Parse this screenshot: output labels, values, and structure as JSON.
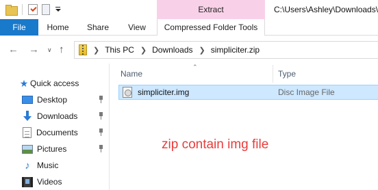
{
  "titlebar": {
    "contextual_tab": "Extract",
    "path": "C:\\Users\\Ashley\\Downloads\\"
  },
  "ribbon": {
    "tabs": [
      "File",
      "Home",
      "Share",
      "View",
      "Compressed Folder Tools"
    ]
  },
  "address": {
    "crumbs": [
      "This PC",
      "Downloads",
      "simpliciter.zip"
    ]
  },
  "sidebar": {
    "items": [
      {
        "label": "Quick access",
        "icon": "star-icon"
      },
      {
        "label": "Desktop",
        "icon": "desktop-icon",
        "pinned": true
      },
      {
        "label": "Downloads",
        "icon": "download-icon",
        "pinned": true
      },
      {
        "label": "Documents",
        "icon": "documents-icon",
        "pinned": true
      },
      {
        "label": "Pictures",
        "icon": "pictures-icon",
        "pinned": true
      },
      {
        "label": "Music",
        "icon": "music-icon"
      },
      {
        "label": "Videos",
        "icon": "videos-icon"
      }
    ]
  },
  "list": {
    "columns": [
      "Name",
      "Type"
    ],
    "rows": [
      {
        "name": "simpliciter.img",
        "type": "Disc Image File",
        "icon": "disc-image-icon",
        "selected": true
      }
    ]
  },
  "annotation": "zip contain img file",
  "colors": {
    "file_tab": "#1979ca",
    "contextual_tab": "#f8d1e8",
    "selection": "#cde8ff",
    "annotation": "#ea3b3b"
  }
}
